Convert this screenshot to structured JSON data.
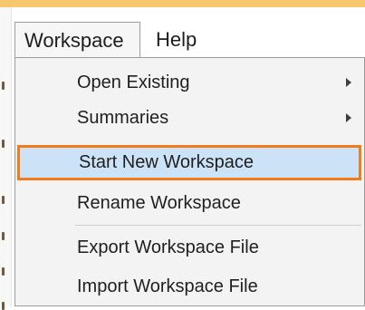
{
  "menubar": {
    "workspace_label": "Workspace",
    "help_label": "Help"
  },
  "workspace_menu": {
    "items": [
      {
        "label": "Open Existing",
        "submenu": true
      },
      {
        "label": "Summaries",
        "submenu": true
      },
      {
        "label": "Start New Workspace",
        "highlighted": true
      },
      {
        "label": "Rename Workspace"
      },
      {
        "label": "Export Workspace File"
      },
      {
        "label": "Import Workspace File"
      }
    ]
  },
  "colors": {
    "highlight_fill": "#cce3f7",
    "highlight_border": "#f07c1b",
    "menu_background": "#f3f3f3",
    "accent_bar": "#f6c76f"
  },
  "icons": {
    "submenu": "chevron-right-icon"
  }
}
